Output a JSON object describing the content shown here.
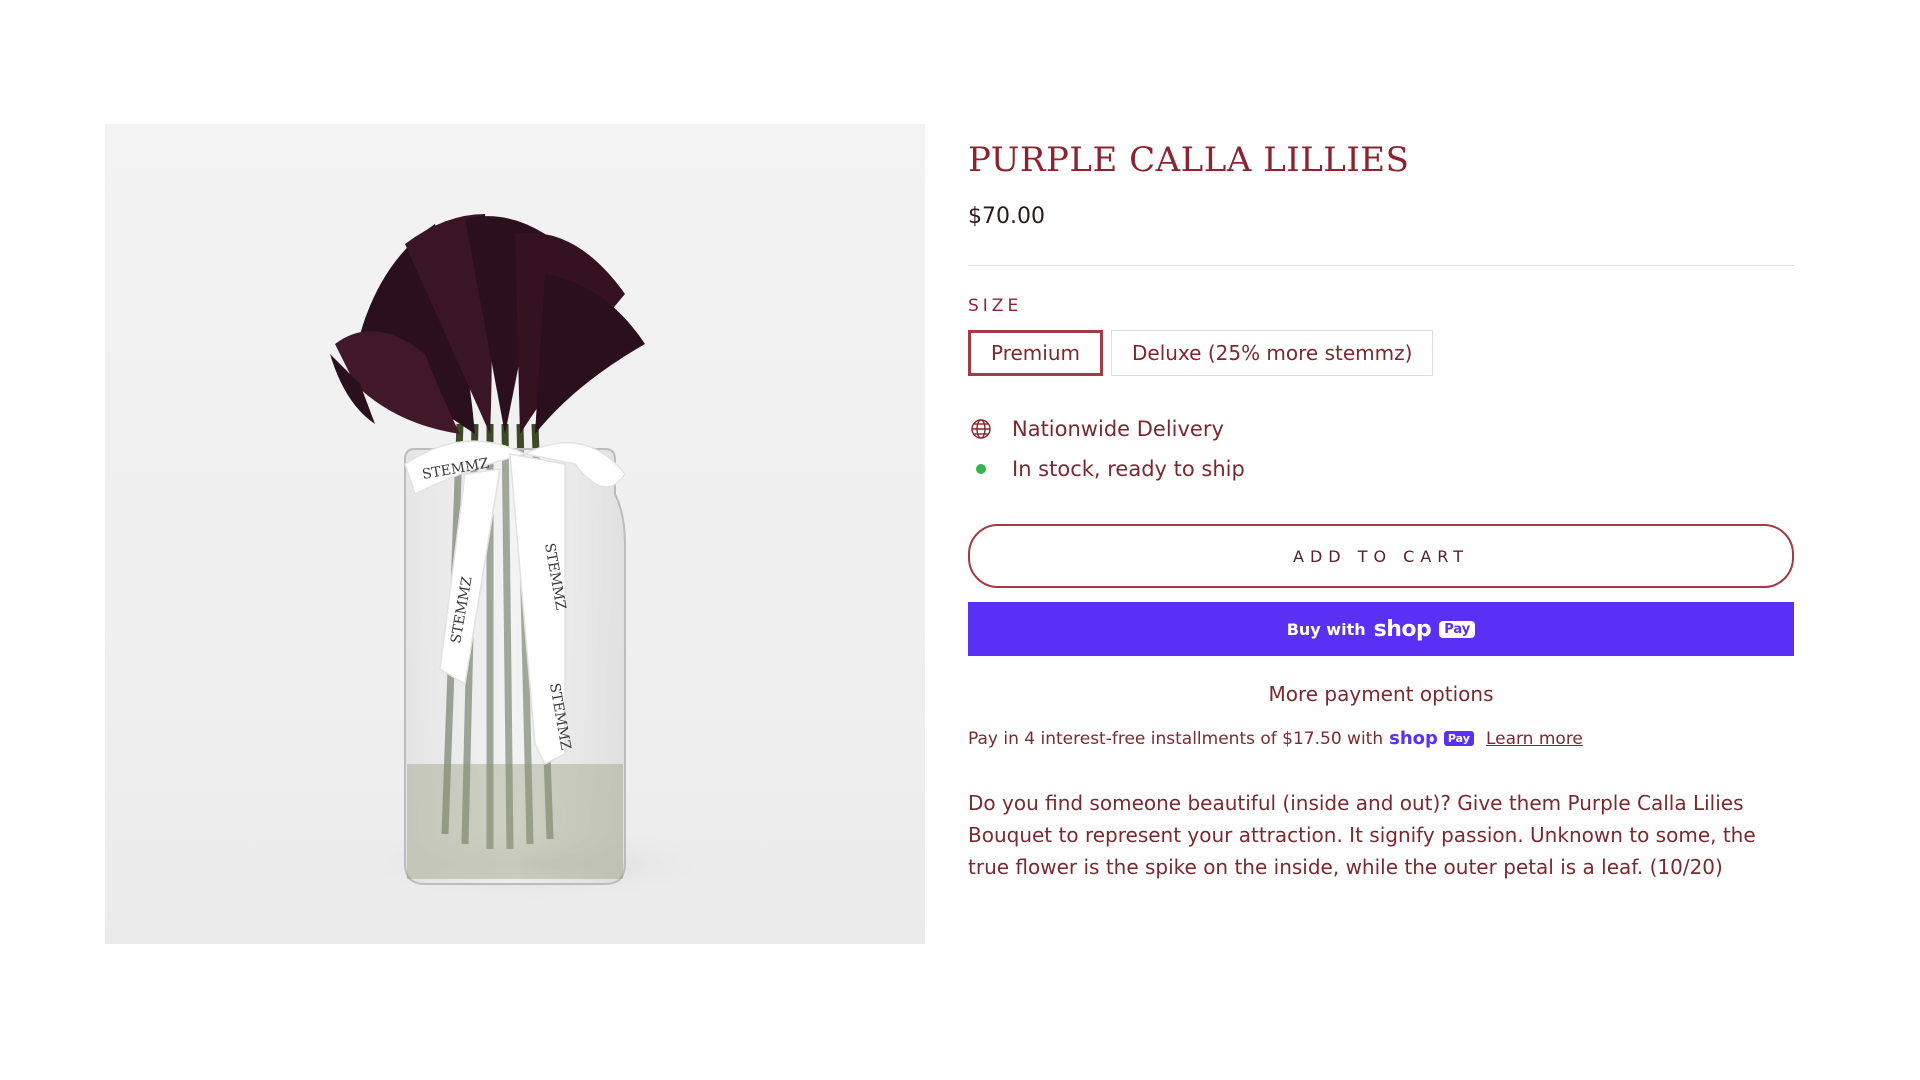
{
  "product": {
    "title": "PURPLE CALLA LILLIES",
    "price": "$70.00",
    "image_alt": "Purple calla lilies bouquet in a glass vase with STEMMZ ribbon",
    "ribbon_text": "STEMMZ"
  },
  "size": {
    "label": "SIZE",
    "options": [
      "Premium",
      "Deluxe (25% more stemmz)"
    ],
    "selected": "Premium"
  },
  "features": {
    "delivery": "Nationwide Delivery",
    "stock": "In stock, ready to ship"
  },
  "buttons": {
    "add_to_cart": "ADD TO CART",
    "buy_with": "Buy with",
    "shop_word": "shop",
    "pay_badge": "Pay",
    "more_payment": "More payment options"
  },
  "installments": {
    "text": "Pay in 4 interest-free installments of $17.50 with",
    "shop_word": "shop",
    "pay_badge": "Pay",
    "learn_more": "Learn more"
  },
  "description": "Do you find someone beautiful (inside and out)? Give them Purple Calla Lilies Bouquet to represent your attraction. It signify passion. Unknown to some, the true flower is the spike on the inside, while the outer petal is a leaf. (10/20)",
  "colors": {
    "accent": "#8b2430",
    "text": "#7a2a2e",
    "shop_pay": "#5a31f4",
    "in_stock": "#32b54a"
  },
  "icons": [
    "globe-icon",
    "in-stock-dot-icon"
  ]
}
